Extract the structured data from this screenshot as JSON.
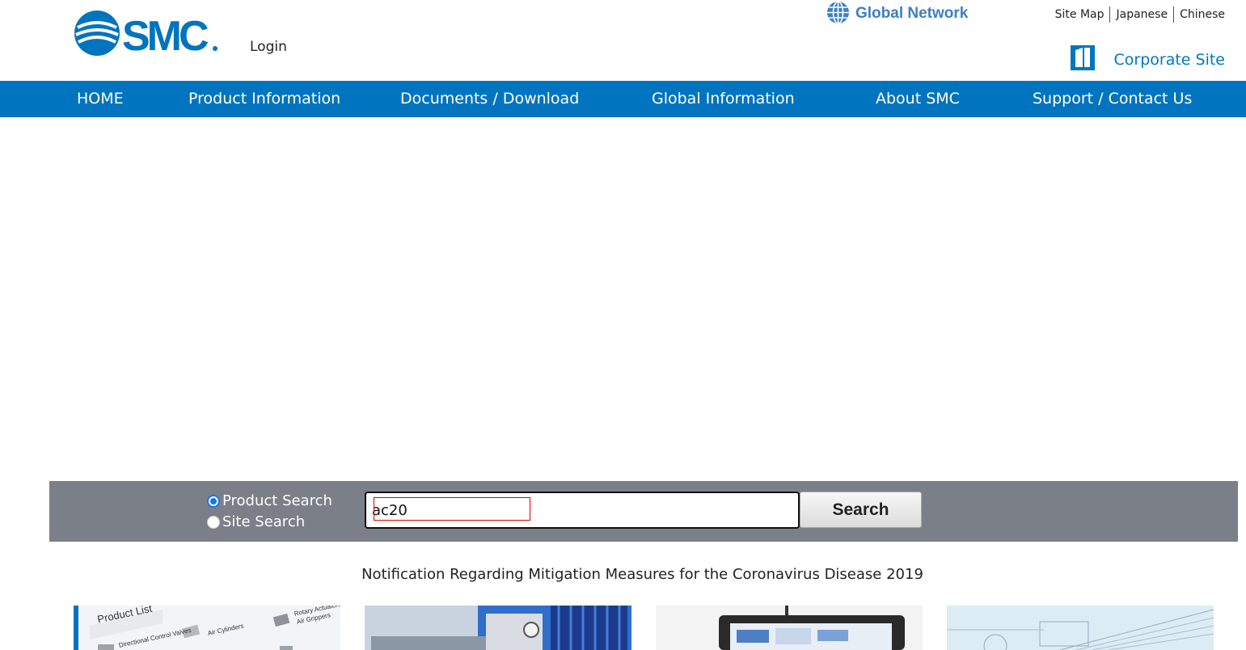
{
  "header": {
    "logo_text": "SMC",
    "login_label": "Login",
    "global_network_label": "Global Network",
    "top_links": [
      "Site Map",
      "Japanese",
      "Chinese"
    ],
    "corporate_site_label": "Corporate Site"
  },
  "nav": {
    "items": [
      {
        "label": "HOME"
      },
      {
        "label": "Product Information"
      },
      {
        "label": "Documents / Download"
      },
      {
        "label": "Global Information"
      },
      {
        "label": "About SMC"
      },
      {
        "label": "Support / Contact Us"
      }
    ]
  },
  "search": {
    "options": [
      {
        "label": "Product Search",
        "selected": true
      },
      {
        "label": "Site Search",
        "selected": false
      }
    ],
    "input_value": "ac20",
    "button_label": "Search"
  },
  "notice": "Notification Regarding Mitigation Measures for the Coronavirus Disease 2019",
  "cards": [
    {
      "title": "Product List",
      "items": [
        "Air Cylinders",
        "Rotary Actuators",
        "Air Grippers",
        "Directional Control Valves"
      ]
    },
    {
      "title": ""
    },
    {
      "title": ""
    },
    {
      "title": ""
    }
  ],
  "colors": {
    "brand": "#0074bf",
    "search_band": "#7b7f87",
    "global_network": "#3d7fc6"
  }
}
